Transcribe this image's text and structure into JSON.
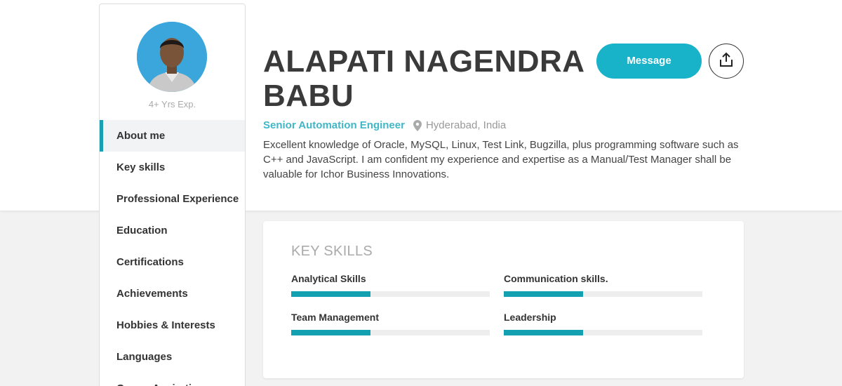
{
  "profile": {
    "experience": "4+ Yrs Exp.",
    "name_line1": "ALAPATI NAGENDRA",
    "name_line2": "BABU",
    "role": "Senior Automation Engineer",
    "location": "Hyderabad, India",
    "summary": "Excellent knowledge of Oracle, MySQL, Linux, Test Link, Bugzilla, plus programming software such as C++ and JavaScript. I am confident my experience and expertise as a Manual/Test Manager shall be valuable for Ichor Business Innovations."
  },
  "actions": {
    "message_label": "Message",
    "share_icon": "share-icon"
  },
  "sidebar": {
    "items": [
      {
        "label": "About me",
        "active": true
      },
      {
        "label": "Key skills"
      },
      {
        "label": "Professional Experience"
      },
      {
        "label": "Education"
      },
      {
        "label": "Certifications"
      },
      {
        "label": "Achievements"
      },
      {
        "label": "Hobbies & Interests"
      },
      {
        "label": "Languages"
      },
      {
        "label": "Career Aspirations"
      }
    ]
  },
  "skills_card": {
    "title": "KEY SKILLS",
    "skills": [
      {
        "label": "Analytical Skills",
        "level": 0.4
      },
      {
        "label": "Communication skills.",
        "level": 0.4
      },
      {
        "label": "Team Management",
        "level": 0.4
      },
      {
        "label": "Leadership",
        "level": 0.4
      }
    ]
  },
  "colors": {
    "accent": "#1aa0b3",
    "button": "#18b2c9",
    "role_text": "#3fb7c8"
  }
}
